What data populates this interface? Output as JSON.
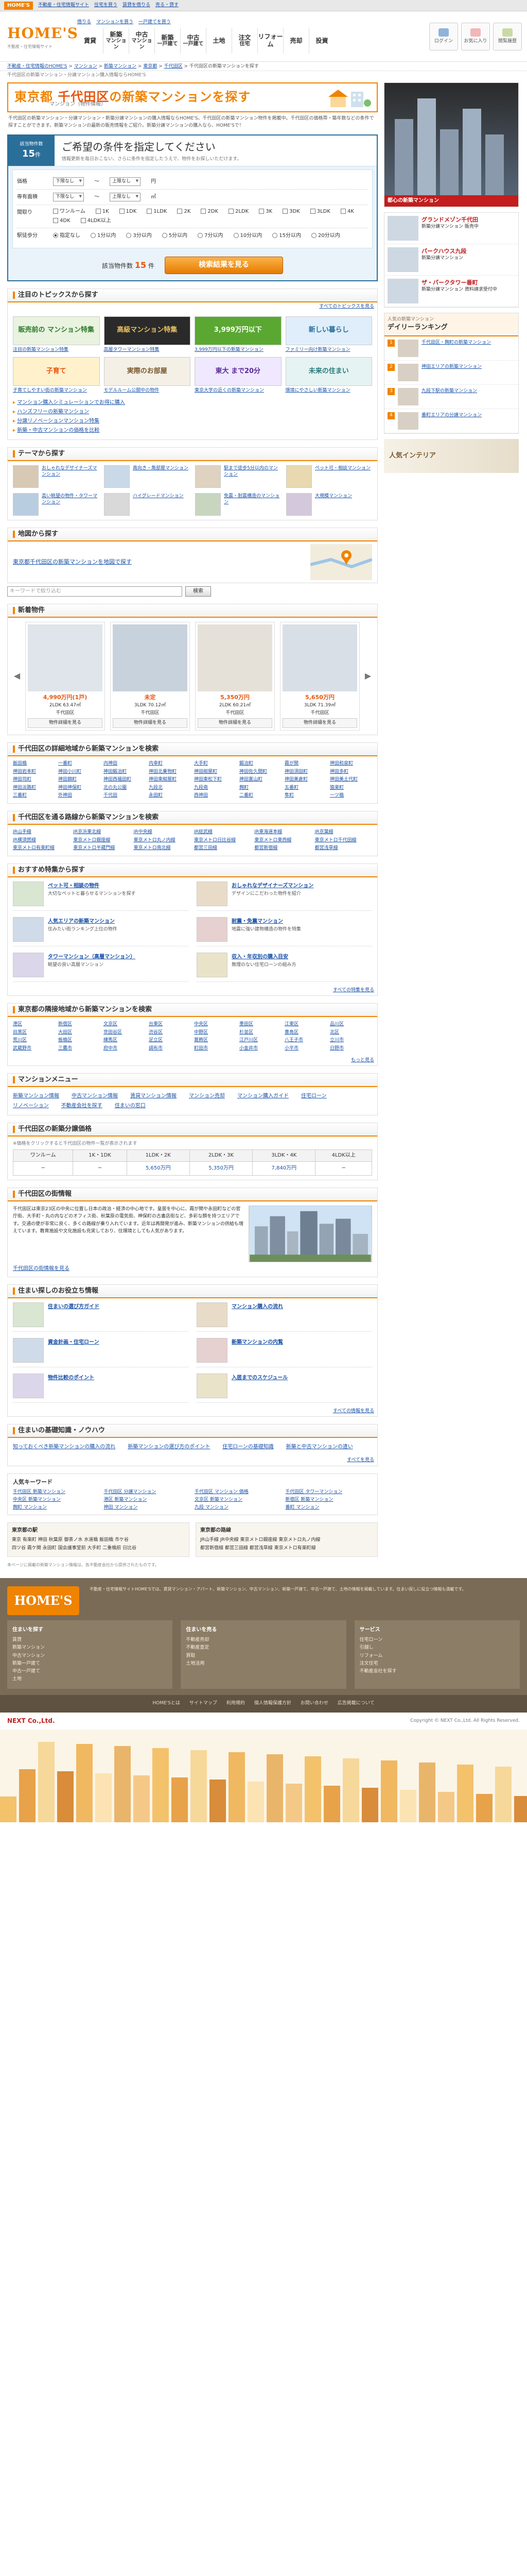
{
  "topbar": {
    "brand": "HOME'S",
    "links": [
      "不動産・住宅情報サイト",
      "住宅を買う",
      "賃貸を借りる",
      "売る・貸す"
    ]
  },
  "header": {
    "logo": "HOME'S",
    "tagline": "不動産・住宅情報サイト",
    "top_links": [
      "借りる",
      "マンションを買う",
      "一戸建てを買う"
    ],
    "nav": [
      {
        "l1": "賃貸",
        "l2": ""
      },
      {
        "l1": "新築",
        "l2": "マンション"
      },
      {
        "l1": "中古",
        "l2": "マンション"
      },
      {
        "l1": "新築",
        "l2": "一戸建て"
      },
      {
        "l1": "中古",
        "l2": "一戸建て"
      },
      {
        "l1": "土地",
        "l2": ""
      },
      {
        "l1": "注文",
        "l2": "住宅"
      },
      {
        "l1": "リフォーム",
        "l2": ""
      },
      {
        "l1": "売却",
        "l2": ""
      },
      {
        "l1": "投資",
        "l2": ""
      }
    ],
    "user_buttons": [
      "ログイン",
      "お気に入り",
      "閲覧履歴"
    ]
  },
  "breadcrumb": [
    "不動産・住宅情報のHOME'S",
    "マンション",
    "新築マンション",
    "東京都",
    "千代田区",
    "千代田区の新築マンションを探す"
  ],
  "utilrow": "千代田区の新築マンション・分譲マンション購入情報ならHOME'S",
  "pagehead": {
    "pre": "東京都",
    "ward": "千代田区",
    "post": "の新築マンションを探す",
    "sub": "マンション（物件情報）"
  },
  "intro": "千代田区の新築マンション・分譲マンション・新築分譲マンションの購入情報ならHOME'S。千代田区の新築マンション物件を掲載中。千代田区の価格帯・築年数などの条件で探すことができます。新築マンションの最新の販売情報をご紹介。新築分譲マンションの購入なら、HOME'Sで！",
  "search": {
    "count_label": "該当物件数",
    "count": "15",
    "count_unit": "件",
    "title": "ご希望の条件を指定してください",
    "subtitle": "情報更新を毎日おこない、さらに条件を指定したうえで、物件をお探しいただけます。",
    "rows": [
      {
        "label": "価格",
        "from": "下限なし",
        "to": "上限なし",
        "unit": "円"
      },
      {
        "label": "専有面積",
        "from": "下限なし",
        "to": "上限なし",
        "unit": "㎡"
      },
      {
        "label": "間取り",
        "options": [
          "ワンルーム",
          "1K",
          "1DK",
          "1LDK",
          "2K",
          "2DK",
          "2LDK",
          "3K",
          "3DK",
          "3LDK",
          "4K",
          "4DK",
          "4LDK以上"
        ]
      },
      {
        "label": "駅徒歩分",
        "options": [
          "指定なし",
          "1分以内",
          "3分以内",
          "5分以内",
          "7分以内",
          "10分以内",
          "15分以内",
          "20分以内"
        ]
      }
    ],
    "result_label": "該当物件数",
    "result_count": "15",
    "result_unit": "件",
    "button": "検索結果を見る"
  },
  "topics": {
    "title": "注目のトピックスから探す",
    "more": "すべてのトピックスを見る",
    "items": [
      {
        "banner": "販売前の マンション特集",
        "caption": "注目の新築マンション特集",
        "color": "#e9f3e0",
        "fg": "#2d7a2d"
      },
      {
        "banner": "高級マンション特集",
        "caption": "高層タワーマンション特集",
        "color": "#2a2a2a",
        "fg": "#e8c060"
      },
      {
        "banner": "3,999万円以下",
        "caption": "3,999万円以下の新築マンション",
        "color": "#5aa832",
        "fg": "#fff"
      },
      {
        "banner": "新しい暮らし",
        "caption": "ファミリー向け新築マンション",
        "color": "#dfeefa",
        "fg": "#2a6e9a"
      },
      {
        "banner": "子育て",
        "caption": "子育てしやすい街の新築マンション",
        "color": "#fff1cc",
        "fg": "#e8540c"
      },
      {
        "banner": "実際のお部屋",
        "caption": "モデルルーム公開中の物件",
        "color": "#f4f0e6",
        "fg": "#7a5a30"
      },
      {
        "banner": "東大 まで20分",
        "caption": "東京大学の近くの新築マンション",
        "color": "#efe8ff",
        "fg": "#5a2a9a"
      },
      {
        "banner": "未来の住まい",
        "caption": "環境にやさしい新築マンション",
        "color": "#e6f3f3",
        "fg": "#2a7a7a"
      }
    ],
    "links": [
      "マンション購入シミュレーションでお得に購入",
      "ハンズフリーの新築マンション",
      "分譲リノベーションマンション特集",
      "新築・中古マンションの価格を比較"
    ]
  },
  "themes": {
    "title": "テーマから探す",
    "items": [
      "おしゃれなデザイナーズマンション",
      "南向き・角部屋マンション",
      "駅まで徒歩5分以内のマンション",
      "ペット可・相談マンション",
      "高い眺望の物件・タワーマンション",
      "ハイグレードマンション",
      "免震・耐震構造のマンション",
      "大規模マンション"
    ]
  },
  "mapsec": {
    "title": "地図から探す",
    "link": "東京都千代田区の新築マンションを地図で探す"
  },
  "keyword": {
    "placeholder": "キーワードで絞り込む",
    "button": "検索"
  },
  "newprops": {
    "title": "新着物件",
    "cards": [
      {
        "price": "4,990万円(1戸)",
        "detail": "2LDK 63.47㎡",
        "loc": "千代田区",
        "link": "物件詳細を見る"
      },
      {
        "price": "未定",
        "detail": "3LDK 70.12㎡",
        "loc": "千代田区",
        "link": "物件詳細を見る"
      },
      {
        "price": "5,350万円",
        "detail": "2LDK 60.21㎡",
        "loc": "千代田区",
        "link": "物件詳細を見る"
      },
      {
        "price": "5,650万円",
        "detail": "3LDK 71.39㎡",
        "loc": "千代田区",
        "link": "物件詳細を見る"
      }
    ]
  },
  "area_links": {
    "title": "千代田区の詳細地域から新築マンションを検索",
    "items": [
      "飯田橋",
      "一番町",
      "内神田",
      "内幸町",
      "大手町",
      "鍛冶町",
      "霞が関",
      "神田和泉町",
      "神田岩本町",
      "神田小川町",
      "神田鍛冶町",
      "神田北乗物町",
      "神田紺屋町",
      "神田佐久間町",
      "神田須田町",
      "神田多町",
      "神田司町",
      "神田錦町",
      "神田西福田町",
      "神田東紺屋町",
      "神田東松下町",
      "神田富山町",
      "神田美倉町",
      "神田美土代町",
      "神田淡路町",
      "神田神保町",
      "北の丸公園",
      "九段北",
      "九段南",
      "麹町",
      "五番町",
      "猿楽町",
      "三番町",
      "外神田",
      "千代田",
      "永田町",
      "西神田",
      "二番町",
      "隼町",
      "一ツ橋"
    ]
  },
  "station_links": {
    "title": "千代田区を通る路線から新築マンションを検索",
    "items": [
      "JR山手線",
      "JR京浜東北線",
      "JR中央線",
      "JR総武線",
      "JR東海道本線",
      "JR京葉線",
      "JR横須賀線",
      "東京メトロ銀座線",
      "東京メトロ丸ノ内線",
      "東京メトロ日比谷線",
      "東京メトロ東西線",
      "東京メトロ千代田線",
      "東京メトロ有楽町線",
      "東京メトロ半蔵門線",
      "東京メトロ南北線",
      "都営三田線",
      "都営新宿線",
      "都営浅草線"
    ]
  },
  "features": {
    "title": "おすすめ特集から探す",
    "more": "すべての特集を見る",
    "items": [
      {
        "t": "ペット可・相談の物件",
        "d": "大切なペットと暮らせるマンションを探す"
      },
      {
        "t": "おしゃれなデザイナーズマンション",
        "d": "デザインにこだわった物件を紹介"
      },
      {
        "t": "人気エリアの新築マンション",
        "d": "住みたい街ランキング上位の物件"
      },
      {
        "t": "耐震・免震マンション",
        "d": "地震に強い建物構造の物件を特集"
      },
      {
        "t": "タワーマンション（高層マンション）",
        "d": "眺望の良い高層マンション"
      },
      {
        "t": "収入・年収別の購入目安",
        "d": "無理のない住宅ローンの組み方"
      }
    ]
  },
  "neighbor": {
    "title": "東京都の隣接地域から新築マンションを検索",
    "items": [
      "港区",
      "新宿区",
      "文京区",
      "台東区",
      "中央区",
      "墨田区",
      "江東区",
      "品川区",
      "目黒区",
      "大田区",
      "世田谷区",
      "渋谷区",
      "中野区",
      "杉並区",
      "豊島区",
      "北区",
      "荒川区",
      "板橋区",
      "練馬区",
      "足立区",
      "葛飾区",
      "江戸川区",
      "八王子市",
      "立川市",
      "武蔵野市",
      "三鷹市",
      "府中市",
      "調布市",
      "町田市",
      "小金井市",
      "小平市",
      "日野市"
    ],
    "more": "もっと見る"
  },
  "menu": {
    "title": "マンションメニュー",
    "links": [
      "新築マンション情報",
      "中古マンション情報",
      "賃貸マンション情報",
      "マンション売却",
      "マンション購入ガイド",
      "住宅ローン",
      "リノベーション",
      "不動産会社を探す",
      "住まいの窓口"
    ]
  },
  "price": {
    "title": "千代田区の新築分譲価格",
    "note": "※価格をクリックすると千代田区の物件一覧が表示されます",
    "headers": [
      "ワンルーム",
      "1K・1DK",
      "1LDK・2K",
      "2LDK・3K",
      "3LDK・4K",
      "4LDK以上"
    ],
    "values": [
      "─",
      "─",
      "5,650万円",
      "5,350万円",
      "7,840万円",
      "─"
    ]
  },
  "ward_info": {
    "title": "千代田区の街情報",
    "text": "千代田区は東京23区の中央に位置し日本の政治・経済の中心地です。皇居を中心に、霞が関や永田町などの官庁街、大手町・丸の内などのオフィス街、秋葉原の電気街、神保町の古書店街など、多彩な顔を持つエリアです。交通の便が非常に良く、多くの路線が乗り入れています。近年は再開発が進み、新築マンションの供給も増えています。教育施設や文化施設も充実しており、住環境としても人気があります。",
    "link": "千代田区の街情報を見る"
  },
  "useful": {
    "title": "住まい探しのお役立ち情報",
    "items": [
      "住まいの選び方ガイド",
      "マンション購入の流れ",
      "資金計画・住宅ローン",
      "新築マンションの内覧",
      "物件比較のポイント",
      "入居までのスケジュール"
    ],
    "more": "すべての情報を見る"
  },
  "knowhow": {
    "title": "住まいの基礎知識・ノウハウ",
    "items": [
      "知っておくべき新築マンションの購入の流れ",
      "新築マンションの選び方のポイント",
      "住宅ローンの基礎知識",
      "新築と中古マンションの違い"
    ],
    "more": "すべてを見る"
  },
  "popular_kw": {
    "title": "人気キーワード",
    "items": [
      "千代田区 新築マンション",
      "千代田区 分譲マンション",
      "千代田区 マンション 価格",
      "千代田区 タワーマンション",
      "中央区 新築マンション",
      "港区 新築マンション",
      "文京区 新築マンション",
      "新宿区 新築マンション",
      "麹町 マンション",
      "神田 マンション",
      "九段 マンション",
      "番町 マンション"
    ]
  },
  "boxes": [
    {
      "title": "東京都の駅",
      "lines": [
        "東京 有楽町 神田 秋葉原 御茶ノ水 水道橋 飯田橋 市ケ谷",
        "四ツ谷 霞ケ関 永田町 国会議事堂前 大手町 二重橋前 日比谷"
      ]
    },
    {
      "title": "東京都の路線",
      "lines": [
        "JR山手線 JR中央線 東京メトロ銀座線 東京メトロ丸ノ内線",
        "都営新宿線 都営三田線 都営浅草線 東京メトロ有楽町線"
      ]
    }
  ],
  "footnote": "本ページに掲載の新築マンション情報は、各不動産会社から提供されたものです。",
  "sidebar": {
    "ad_band": "都心の新築マンション",
    "ad_rows": [
      {
        "t": "グランドメゾン千代田",
        "d": "新築分譲マンション 販売中"
      },
      {
        "t": "パークハウス九段",
        "d": "新築分譲マンション"
      },
      {
        "t": "ザ・パークタワー番町",
        "d": "新築分譲マンション 資料請求受付中"
      }
    ],
    "ranking": {
      "sub": "人気の新築マンション",
      "title": "デイリーランキング",
      "items": [
        "千代田区・麹町の新築マンション",
        "神田エリアの新築マンション",
        "九段下駅の新築マンション",
        "番町エリアの分譲マンション"
      ]
    },
    "interior": "人気インテリア"
  },
  "footer": {
    "logo": "HOME'S",
    "desc": "不動産・住宅情報サイトHOME'Sでは、賃貸マンション・アパート、新築マンション、中古マンション、新築一戸建て、中古一戸建て、土地の情報を掲載しています。住まい探しに役立つ情報も満載です。",
    "cols": [
      {
        "h": "住まいを探す",
        "items": [
          "賃貸",
          "新築マンション",
          "中古マンション",
          "新築一戸建て",
          "中古一戸建て",
          "土地"
        ]
      },
      {
        "h": "住まいを売る",
        "items": [
          "不動産売却",
          "不動産査定",
          "買取",
          "土地活用"
        ]
      },
      {
        "h": "サービス",
        "items": [
          "住宅ローン",
          "引越し",
          "リフォーム",
          "注文住宅",
          "不動産会社を探す"
        ]
      }
    ],
    "bottom": [
      "HOME'Sとは",
      "サイトマップ",
      "利用規約",
      "個人情報保護方針",
      "お問い合わせ",
      "広告掲載について"
    ],
    "company": "NEXT Co.,Ltd.",
    "copyright": "Copyright © NEXT Co.,Ltd. All Rights Reserved."
  }
}
